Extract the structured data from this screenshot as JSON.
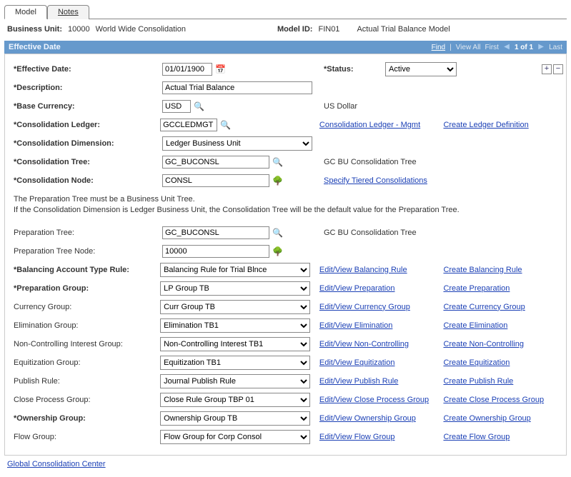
{
  "tabs": {
    "model": "Model",
    "notes": "Notes"
  },
  "header": {
    "business_unit_label": "Business Unit:",
    "business_unit_value": "10000",
    "business_unit_desc": "World Wide Consolidation",
    "model_id_label": "Model ID:",
    "model_id_value": "FIN01",
    "model_id_desc": "Actual Trial Balance Model"
  },
  "section": {
    "title": "Effective Date",
    "find": "Find",
    "view_all": "View All",
    "first": "First",
    "position": "1 of 1",
    "last": "Last"
  },
  "fields": {
    "eff_date_label": "*Effective Date:",
    "eff_date_value": "01/01/1900",
    "status_label": "*Status:",
    "status_value": "Active",
    "desc_label": "*Description:",
    "desc_value": "Actual Trial Balance",
    "base_curr_label": "*Base Currency:",
    "base_curr_value": "USD",
    "base_curr_desc": "US Dollar",
    "cons_ledger_label": "*Consolidation Ledger:",
    "cons_ledger_value": "GCCLEDMGT",
    "cons_ledger_link": "Consolidation Ledger - Mgmt",
    "create_ledger_def": "Create Ledger Definition",
    "cons_dim_label": "*Consolidation Dimension:",
    "cons_dim_value": "Ledger Business Unit",
    "cons_tree_label": "*Consolidation Tree:",
    "cons_tree_value": "GC_BUCONSL",
    "cons_tree_desc": "GC BU Consolidation Tree",
    "cons_node_label": "*Consolidation Node:",
    "cons_node_value": "CONSL",
    "specify_tiered": "Specify Tiered Consolidations",
    "note_line1": "The Preparation Tree must be a Business Unit Tree.",
    "note_line2": "If the Consolidation Dimension is Ledger Business Unit, the Consolidation Tree will be the default value for the Preparation Tree.",
    "prep_tree_label": "Preparation Tree:",
    "prep_tree_value": "GC_BUCONSL",
    "prep_tree_desc": "GC BU Consolidation Tree",
    "prep_node_label": "Preparation Tree Node:",
    "prep_node_value": "10000",
    "bal_rule_label": "*Balancing Account Type Rule:",
    "bal_rule_value": "Balancing Rule for Trial Blnce",
    "bal_rule_edit": "Edit/View Balancing Rule",
    "bal_rule_create": "Create Balancing Rule",
    "prep_group_label": "*Preparation Group:",
    "prep_group_value": "LP Group TB",
    "prep_group_edit": "Edit/View Preparation",
    "prep_group_create": "Create Preparation",
    "curr_group_label": "Currency Group:",
    "curr_group_value": "Curr Group TB",
    "curr_group_edit": "Edit/View Currency Group",
    "curr_group_create": "Create Currency Group",
    "elim_group_label": "Elimination Group:",
    "elim_group_value": "Elimination TB1",
    "elim_group_edit": "Edit/View Elimination",
    "elim_group_create": "Create Elimination",
    "nci_group_label": "Non-Controlling Interest Group:",
    "nci_group_value": "Non-Controlling Interest TB1",
    "nci_group_edit": "Edit/View Non-Controlling",
    "nci_group_create": "Create Non-Controlling",
    "equit_group_label": "Equitization Group:",
    "equit_group_value": "Equitization TB1",
    "equit_group_edit": "Edit/View Equitization",
    "equit_group_create": "Create Equitization",
    "pub_rule_label": "Publish Rule:",
    "pub_rule_value": "Journal Publish Rule",
    "pub_rule_edit": "Edit/View Publish Rule",
    "pub_rule_create": "Create Publish Rule",
    "close_group_label": "Close Process Group:",
    "close_group_value": "Close Rule Group TBP 01",
    "close_group_edit": "Edit/View Close Process Group",
    "close_group_create": "Create Close Process Group",
    "own_group_label": "*Ownership Group:",
    "own_group_value": "Ownership Group TB",
    "own_group_edit": "Edit/View Ownership Group",
    "own_group_create": "Create Ownership Group",
    "flow_group_label": "Flow Group:",
    "flow_group_value": "Flow Group for Corp Consol",
    "flow_group_edit": "Edit/View Flow Group",
    "flow_group_create": "Create Flow Group"
  },
  "bottom": {
    "gcc_link": "Global Consolidation Center"
  }
}
